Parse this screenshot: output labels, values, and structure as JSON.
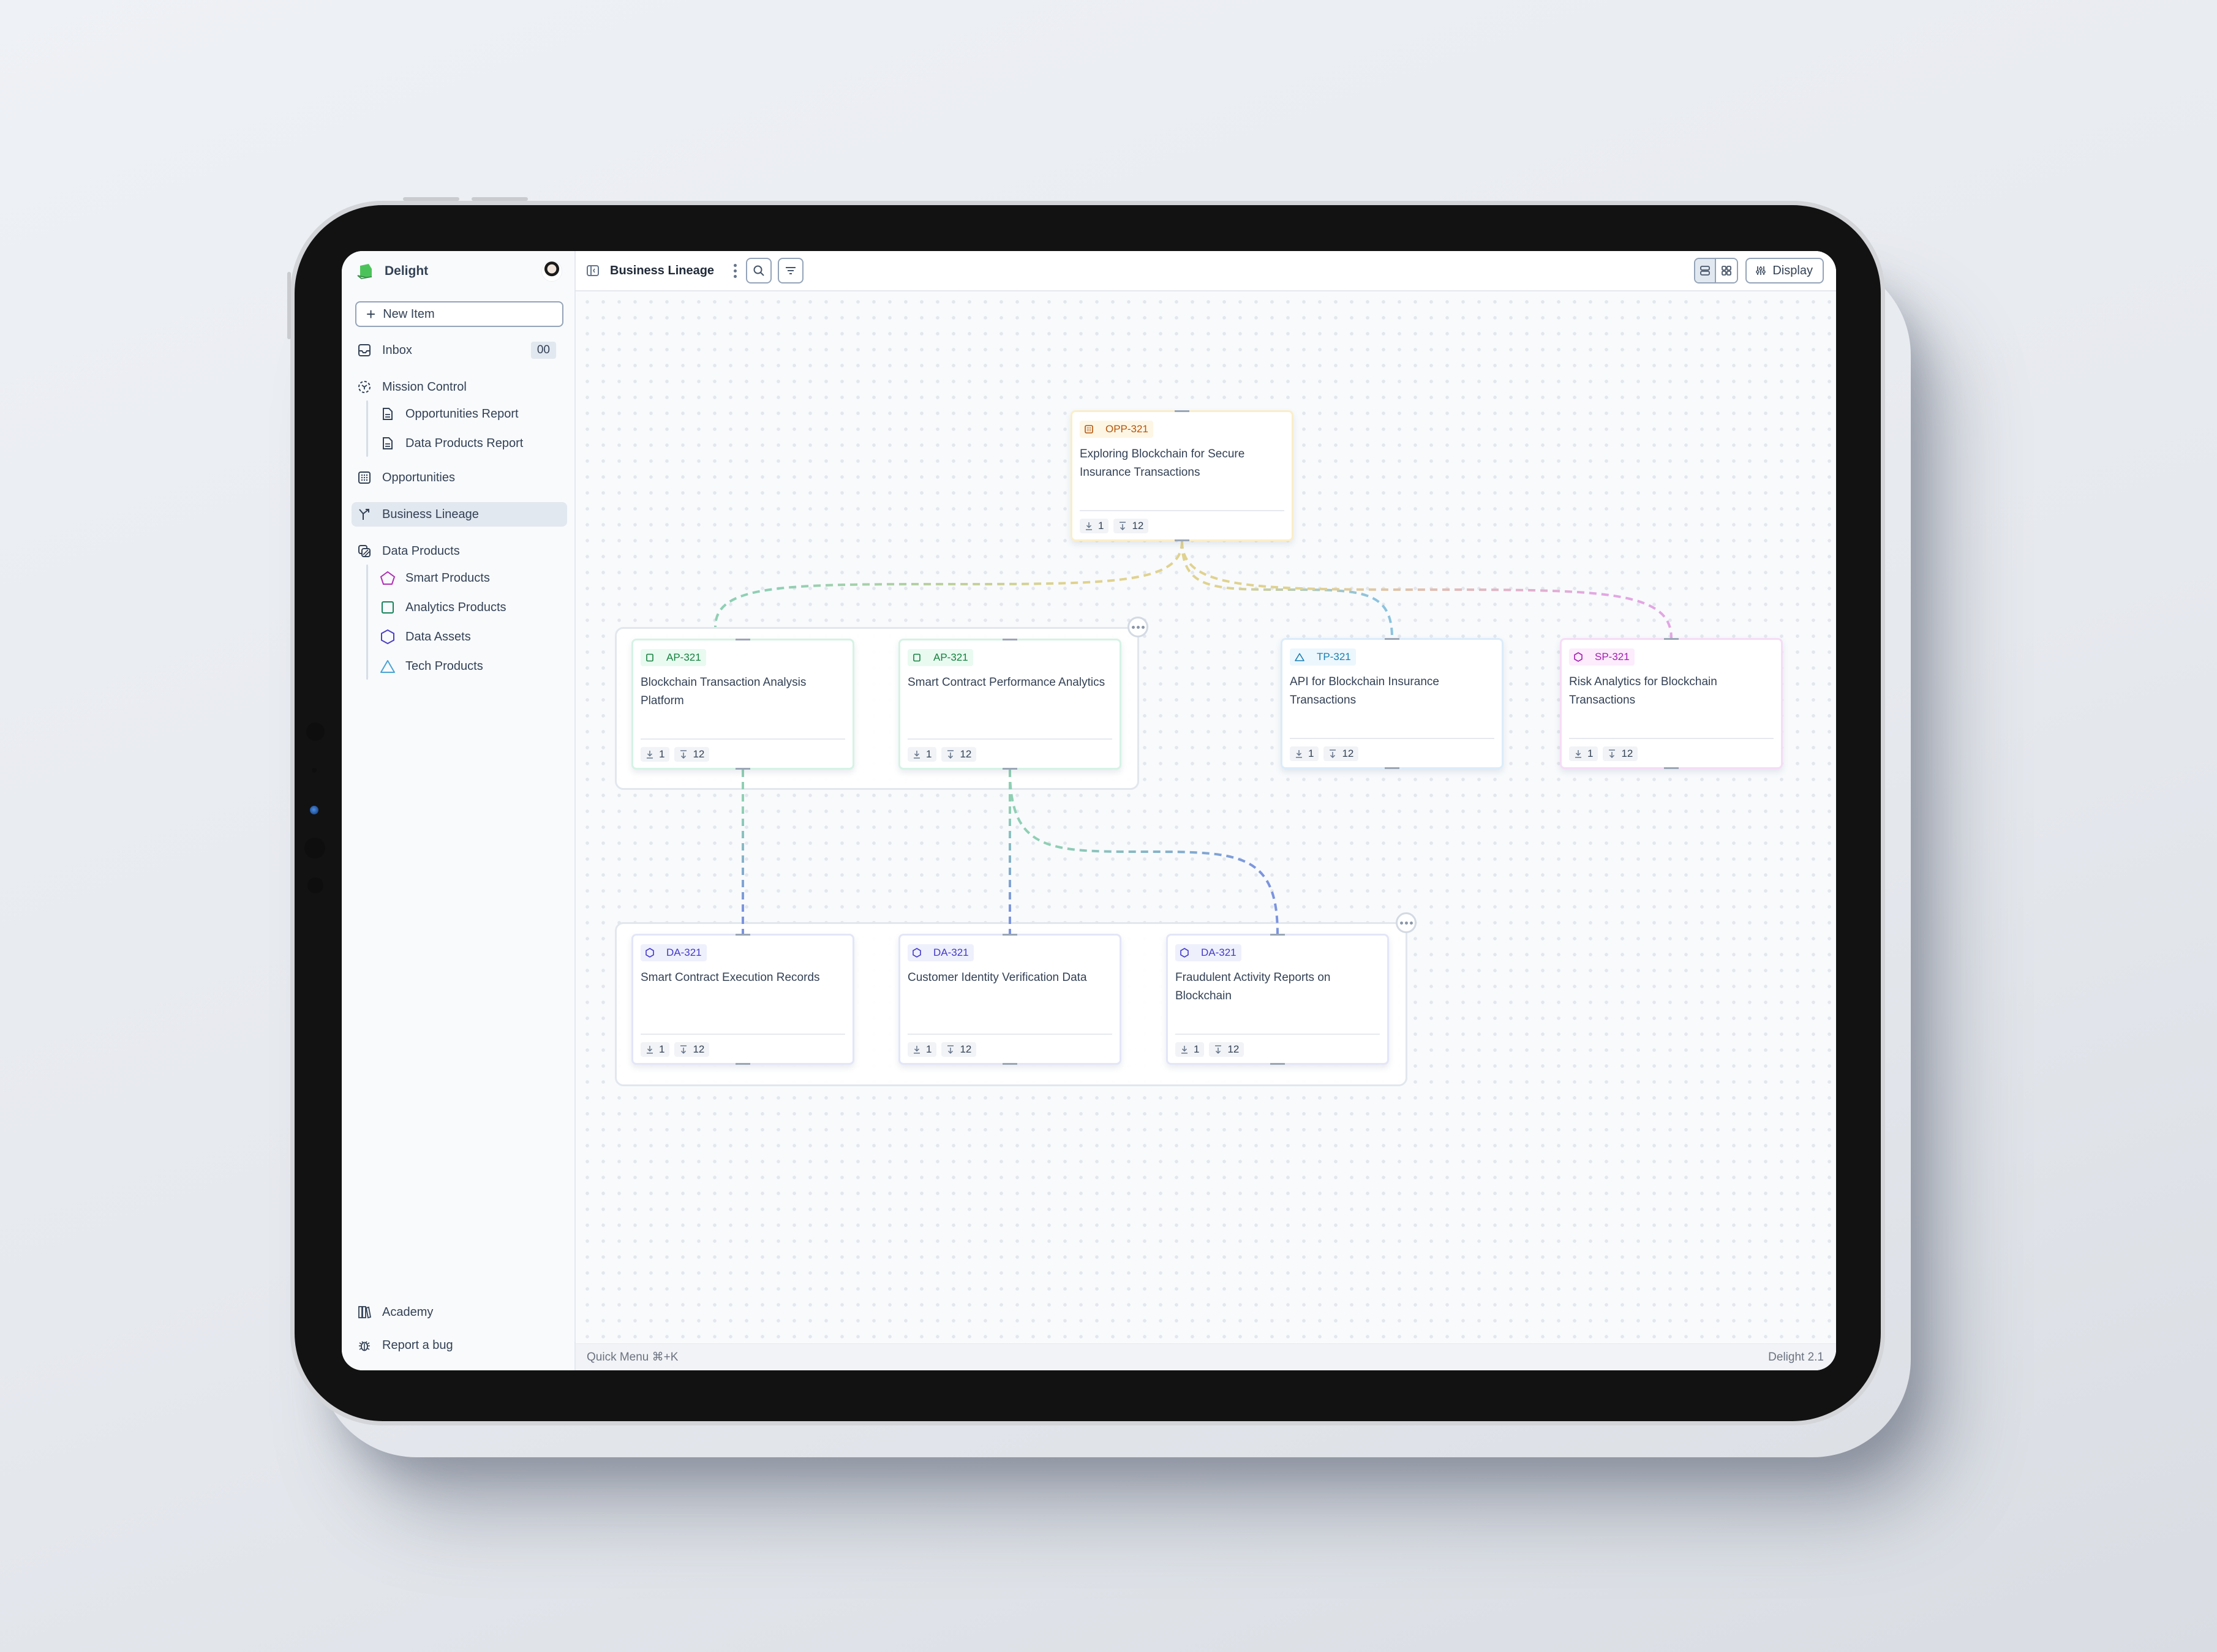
{
  "app": {
    "name": "Delight",
    "version_label": "Delight 2.1",
    "quick_menu_label": "Quick Menu ⌘+K"
  },
  "sidebar": {
    "new_item_label": "New Item",
    "items": [
      {
        "id": "inbox",
        "label": "Inbox",
        "icon": "inbox-icon",
        "count": "00"
      },
      {
        "id": "mission-control",
        "label": "Mission Control",
        "icon": "mission-control-icon",
        "children": [
          {
            "label": "Opportunities Report",
            "icon": "document-icon"
          },
          {
            "label": "Data Products Report",
            "icon": "document-icon"
          }
        ]
      },
      {
        "id": "opportunities",
        "label": "Opportunities",
        "icon": "grid-icon"
      },
      {
        "id": "business-lineage",
        "label": "Business Lineage",
        "icon": "lineage-icon",
        "active": true
      },
      {
        "id": "data-products",
        "label": "Data Products",
        "icon": "data-products-icon",
        "children": [
          {
            "label": "Smart Products",
            "icon": "pentagon-icon",
            "color": "#b02fb5"
          },
          {
            "label": "Analytics Products",
            "icon": "square-icon",
            "color": "#17835a"
          },
          {
            "label": "Data Assets",
            "icon": "hexagon-icon",
            "color": "#4b3fc4"
          },
          {
            "label": "Tech Products",
            "icon": "triangle-icon",
            "color": "#4aa3d3"
          }
        ]
      }
    ],
    "footer": [
      {
        "label": "Academy",
        "icon": "books-icon"
      },
      {
        "label": "Report a bug",
        "icon": "bug-icon"
      }
    ]
  },
  "topbar": {
    "title": "Business Lineage",
    "display_label": "Display",
    "view_modes": [
      "list-view",
      "grid-view"
    ],
    "active_view": "list-view"
  },
  "lineage": {
    "nodes": [
      {
        "id": "opp",
        "type": "opp",
        "code": "OPP-321",
        "title": "Exploring Blockchain for Secure Insurance Transactions",
        "upstream": "1",
        "downstream": "12",
        "color": "#b45309",
        "tag_bg": "#fef6e4",
        "icon": "grid-icon"
      },
      {
        "id": "ap1",
        "type": "ap",
        "code": "AP-321",
        "title": "Blockchain Transaction Analysis Platform",
        "upstream": "1",
        "downstream": "12",
        "color": "#15803d",
        "tag_bg": "#e9faf1",
        "icon": "square-icon"
      },
      {
        "id": "ap2",
        "type": "ap",
        "code": "AP-321",
        "title": "Smart Contract Performance Analytics",
        "upstream": "1",
        "downstream": "12",
        "color": "#15803d",
        "tag_bg": "#e9faf1",
        "icon": "square-icon"
      },
      {
        "id": "tp",
        "type": "tp",
        "code": "TP-321",
        "title": "API for Blockchain Insurance Transactions",
        "upstream": "1",
        "downstream": "12",
        "color": "#1a7fb0",
        "tag_bg": "#ecf6fd",
        "icon": "triangle-icon"
      },
      {
        "id": "sp",
        "type": "sp",
        "code": "SP-321",
        "title": "Risk Analytics for Blockchain Transactions",
        "upstream": "1",
        "downstream": "12",
        "color": "#a21caf",
        "tag_bg": "#fcecfc",
        "icon": "hexagon-icon"
      },
      {
        "id": "da1",
        "type": "da",
        "code": "DA-321",
        "title": "Smart Contract Execution Records",
        "upstream": "1",
        "downstream": "12",
        "color": "#4338ca",
        "tag_bg": "#eef0fc",
        "icon": "hexagon-icon"
      },
      {
        "id": "da2",
        "type": "da",
        "code": "DA-321",
        "title": "Customer Identity Verification Data",
        "upstream": "1",
        "downstream": "12",
        "color": "#4338ca",
        "tag_bg": "#eef0fc",
        "icon": "hexagon-icon"
      },
      {
        "id": "da3",
        "type": "da",
        "code": "DA-321",
        "title": "Fraudulent Activity Reports on Blockchain",
        "upstream": "1",
        "downstream": "12",
        "color": "#4338ca",
        "tag_bg": "#eef0fc",
        "icon": "hexagon-icon"
      }
    ],
    "edges": [
      {
        "from": "opp",
        "to": "group-ap",
        "from_color": "#e0d28e",
        "to_color": "#8fcfb4"
      },
      {
        "from": "opp",
        "to": "tp",
        "from_color": "#e0d28e",
        "to_color": "#8cc2de"
      },
      {
        "from": "opp",
        "to": "sp",
        "from_color": "#e0d28e",
        "to_color": "#e3a6e3"
      },
      {
        "from": "ap1",
        "to": "da1",
        "from_color": "#8fcfb4",
        "to_color": "#7b94e0"
      },
      {
        "from": "ap2",
        "to": "da2",
        "from_color": "#8fcfb4",
        "to_color": "#7b94e0"
      },
      {
        "from": "ap2",
        "to": "da3",
        "from_color": "#8fcfb4",
        "to_color": "#7b94e0"
      }
    ],
    "groups": [
      {
        "id": "group-ap",
        "members": [
          "ap1",
          "ap2"
        ]
      },
      {
        "id": "group-da",
        "members": [
          "da1",
          "da2",
          "da3"
        ]
      }
    ]
  }
}
